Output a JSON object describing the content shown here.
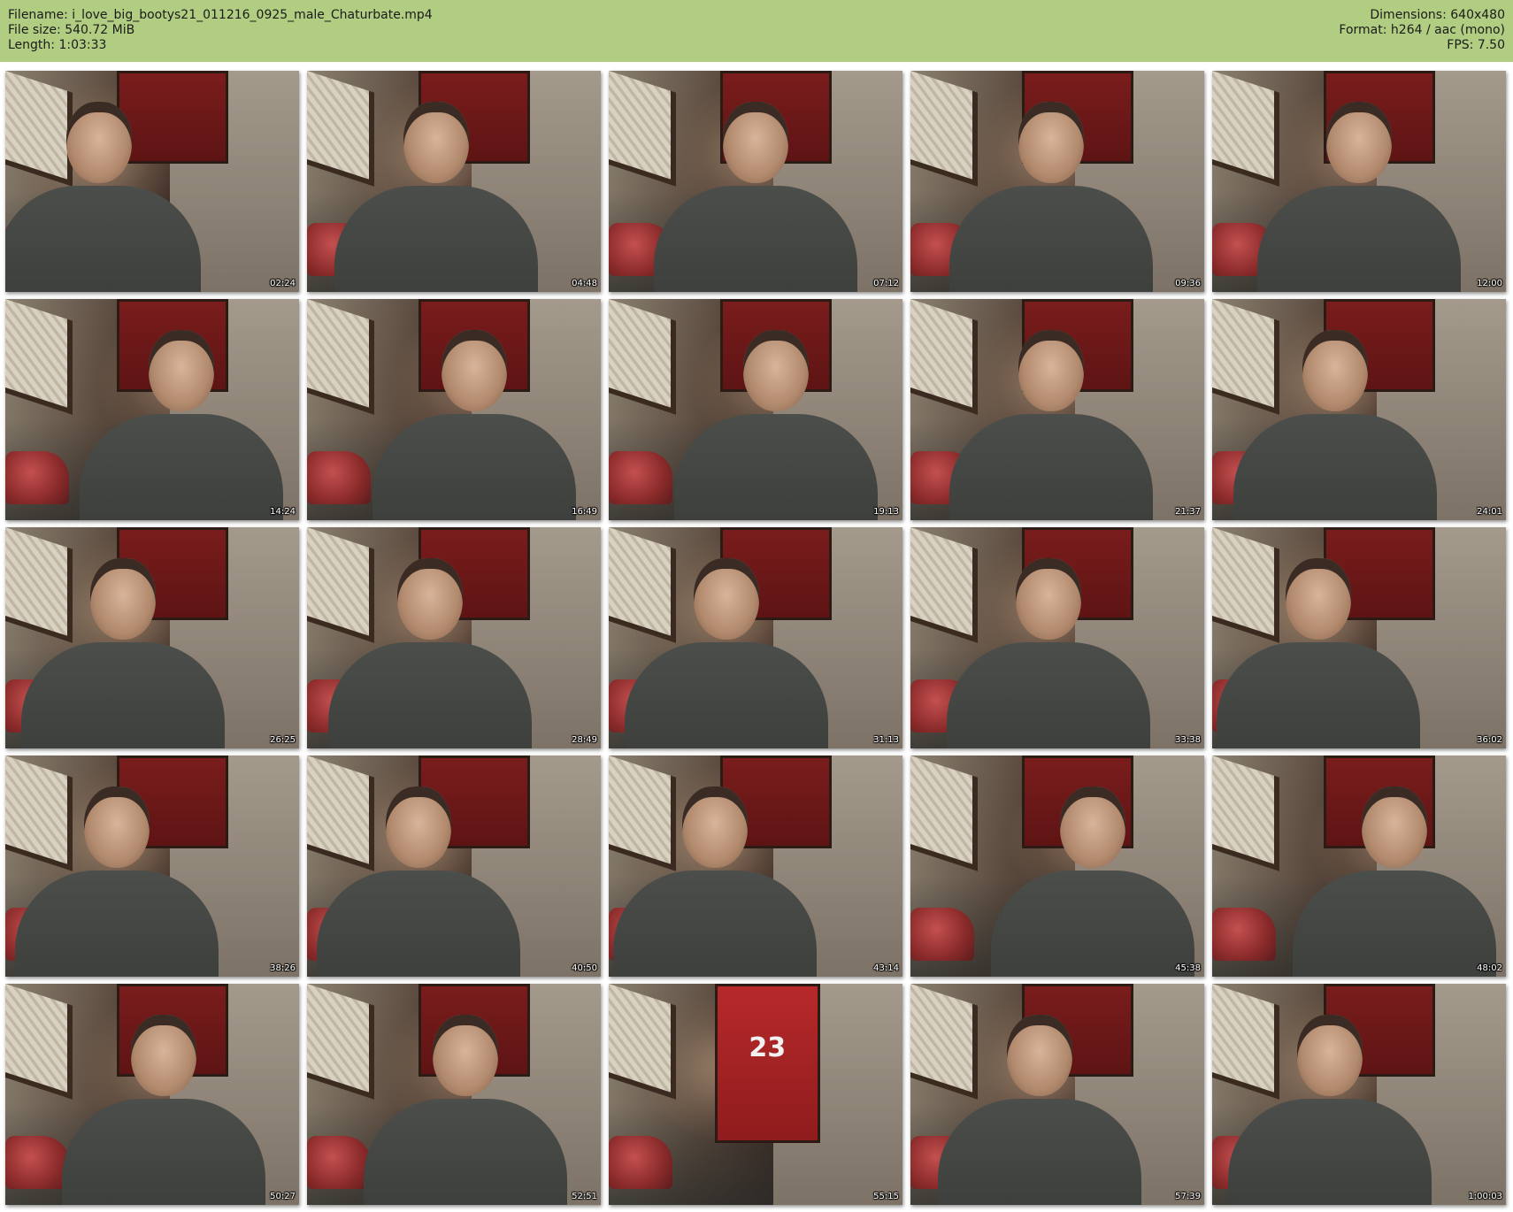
{
  "header": {
    "filename_label": "Filename: i_love_big_bootys21_011216_0925_male_Chaturbate.mp4",
    "filesize_label": "File size: 540.72 MiB",
    "length_label": "Length: 1:03:33",
    "dimensions_label": "Dimensions: 640x480",
    "format_label": "Format: h264 / aac (mono)",
    "fps_label": "FPS: 7.50"
  },
  "thumbnails": [
    {
      "timestamp": "02:24"
    },
    {
      "timestamp": "04:48"
    },
    {
      "timestamp": "07:12"
    },
    {
      "timestamp": "09:36"
    },
    {
      "timestamp": "12:00"
    },
    {
      "timestamp": "14:24"
    },
    {
      "timestamp": "16:49"
    },
    {
      "timestamp": "19:13"
    },
    {
      "timestamp": "21:37"
    },
    {
      "timestamp": "24:01"
    },
    {
      "timestamp": "26:25"
    },
    {
      "timestamp": "28:49"
    },
    {
      "timestamp": "31:13"
    },
    {
      "timestamp": "33:38"
    },
    {
      "timestamp": "36:02"
    },
    {
      "timestamp": "38:26"
    },
    {
      "timestamp": "40:50"
    },
    {
      "timestamp": "43:14"
    },
    {
      "timestamp": "45:38"
    },
    {
      "timestamp": "48:02"
    },
    {
      "timestamp": "50:27"
    },
    {
      "timestamp": "52:51"
    },
    {
      "timestamp": "55:15",
      "jersey_number": "23"
    },
    {
      "timestamp": "57:39"
    },
    {
      "timestamp": "1:00:03"
    }
  ],
  "colors": {
    "header_background": "#b1cd81",
    "page_background": "#ffffff",
    "timestamp_text": "#ffffff"
  }
}
